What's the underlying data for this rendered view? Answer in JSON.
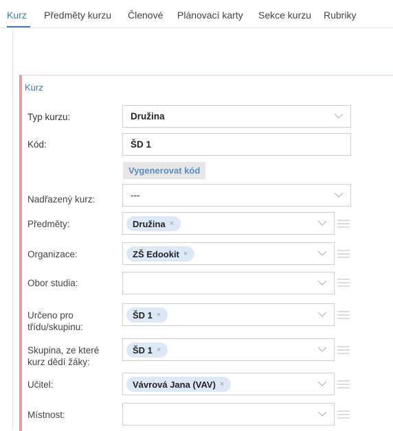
{
  "tabs": [
    {
      "label": "Kurz",
      "active": true
    },
    {
      "label": "Předměty kurzu"
    },
    {
      "label": "Členové"
    },
    {
      "label": "Plánovací karty"
    },
    {
      "label": "Sekce kurzu"
    },
    {
      "label": "Rubriky"
    }
  ],
  "section_title": "Kurz",
  "form": {
    "typ_kurzu": {
      "label": "Typ kurzu:",
      "value": "Družina"
    },
    "kod": {
      "label": "Kód:",
      "value": "ŠD 1"
    },
    "generate_button": "Vygenerovat kód",
    "nadrazeny_kurz": {
      "label": "Nadřazený kurz:",
      "value": "---"
    },
    "predmety": {
      "label": "Předměty:",
      "chips": [
        "Družina"
      ]
    },
    "organizace": {
      "label": "Organizace:",
      "chips": [
        "ZŠ Edookit"
      ]
    },
    "obor_studia": {
      "label": "Obor studia:",
      "chips": []
    },
    "urceno_pro": {
      "label_line1": "Určeno pro",
      "label_line2": "třídu/skupinu:",
      "chips": [
        "ŠD 1"
      ]
    },
    "skupina": {
      "label_line1": "Skupina, ze které",
      "label_line2": "kurz dědí žáky:",
      "chips": [
        "ŠD 1"
      ]
    },
    "ucitel": {
      "label": "Učitel:",
      "chips": [
        "Vávrová Jana (VAV)"
      ]
    },
    "mistnost": {
      "label": "Místnost:",
      "chips": []
    }
  },
  "chip_remove_glyph": "×",
  "colors": {
    "accent": "#3a78c3",
    "chip_bg": "#dde8f6",
    "panel_border": "#ea9a9a"
  }
}
